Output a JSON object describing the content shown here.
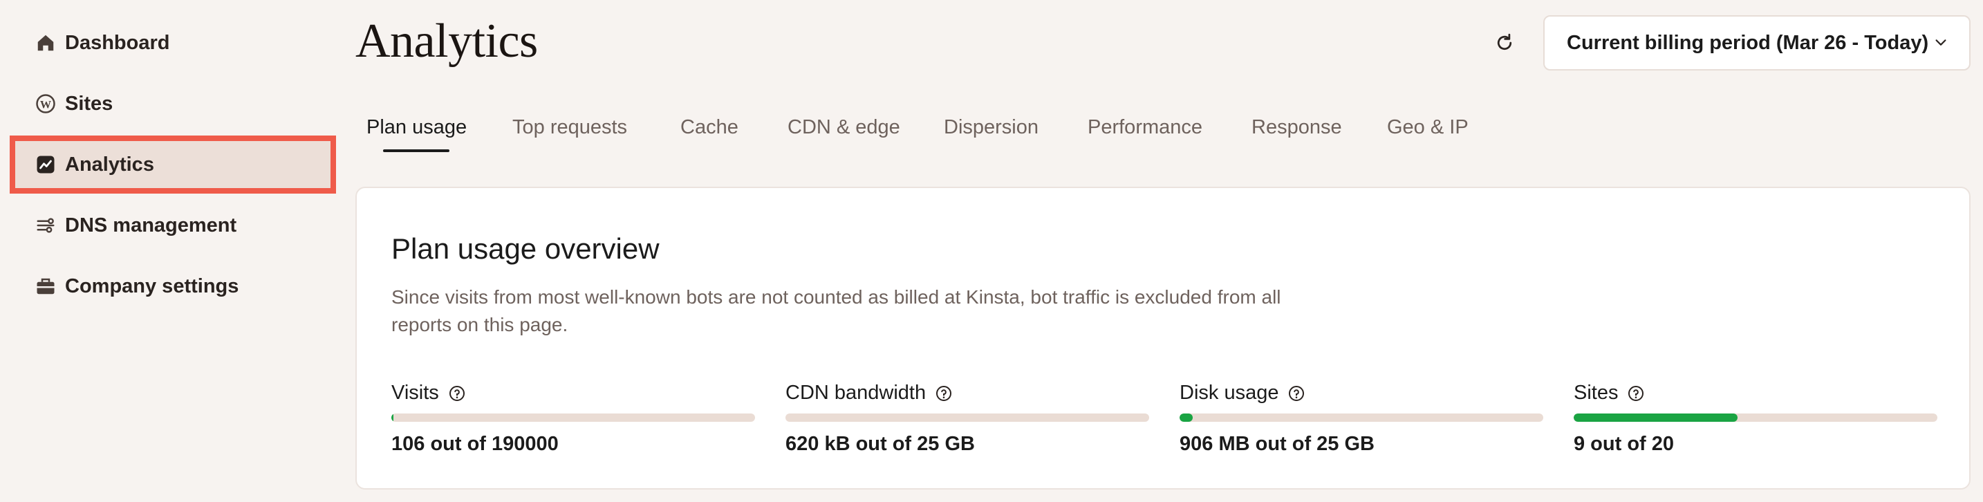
{
  "sidebar": {
    "items": [
      {
        "label": "Dashboard",
        "icon": "home-icon",
        "active": false
      },
      {
        "label": "Sites",
        "icon": "wordpress-icon",
        "active": false
      },
      {
        "label": "Analytics",
        "icon": "chart-icon",
        "active": true
      },
      {
        "label": "DNS management",
        "icon": "dns-icon",
        "active": false
      },
      {
        "label": "Company settings",
        "icon": "briefcase-icon",
        "active": false
      }
    ]
  },
  "header": {
    "title": "Analytics",
    "refresh_icon": "refresh-icon",
    "period_select": {
      "value": "Current billing period (Mar 26 - Today)",
      "icon": "chevron-down-icon"
    }
  },
  "tabs": [
    {
      "label": "Plan usage",
      "active": true
    },
    {
      "label": "Top requests",
      "active": false
    },
    {
      "label": "Cache",
      "active": false
    },
    {
      "label": "CDN & edge",
      "active": false
    },
    {
      "label": "Dispersion",
      "active": false
    },
    {
      "label": "Performance",
      "active": false
    },
    {
      "label": "Response",
      "active": false
    },
    {
      "label": "Geo & IP",
      "active": false
    }
  ],
  "overview": {
    "title": "Plan usage overview",
    "description": "Since visits from most well-known bots are not counted as billed at Kinsta, bot traffic is excluded from all reports on this page.",
    "metrics": [
      {
        "label": "Visits",
        "value": "106 out of 190000",
        "usage_fraction": 0.0006
      },
      {
        "label": "CDN bandwidth",
        "value": "620 kB out of 25 GB",
        "usage_fraction": 0.0
      },
      {
        "label": "Disk usage",
        "value": "906 MB out of 25 GB",
        "usage_fraction": 0.036
      },
      {
        "label": "Sites",
        "value": "9 out of 20",
        "usage_fraction": 0.45
      }
    ]
  },
  "colors": {
    "background": "#f7f3f0",
    "active_nav": "#ecdfd8",
    "highlight_border": "#ef5b4a",
    "progress_fill": "#1aa443",
    "progress_track": "#eadcd4",
    "muted_text": "#6e625d"
  }
}
